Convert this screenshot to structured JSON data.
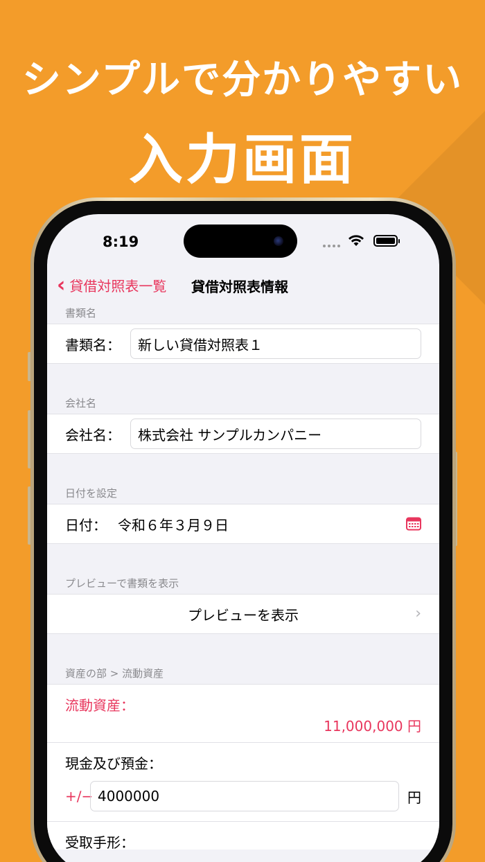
{
  "promo": {
    "headline1": "シンプルで分かりやすい",
    "headline2": "入力画面"
  },
  "status_bar": {
    "time": "8:19"
  },
  "nav": {
    "back_label": "貸借対照表一覧",
    "title": "貸借対照表情報"
  },
  "sections": {
    "doc_name": {
      "header": "書類名",
      "label": "書類名：",
      "value": "新しい貸借対照表１"
    },
    "company": {
      "header": "会社名",
      "label": "会社名：",
      "value": "株式会社 サンプルカンパニー"
    },
    "date": {
      "header": "日付を設定",
      "label": "日付：",
      "value": "令和６年３月９日"
    },
    "preview": {
      "header": "プレビューで書類を表示",
      "label": "プレビューを表示"
    },
    "assets": {
      "header": "資産の部 > 流動資産",
      "total_label": "流動資産：",
      "total_value": "11,000,000 円",
      "items": [
        {
          "label": "現金及び預金：",
          "sign_toggle": "+∕−",
          "value": "4000000",
          "unit": "円"
        },
        {
          "label": "受取手形："
        }
      ]
    }
  },
  "colors": {
    "background": "#F39C2A",
    "accent": "#E8365D"
  }
}
